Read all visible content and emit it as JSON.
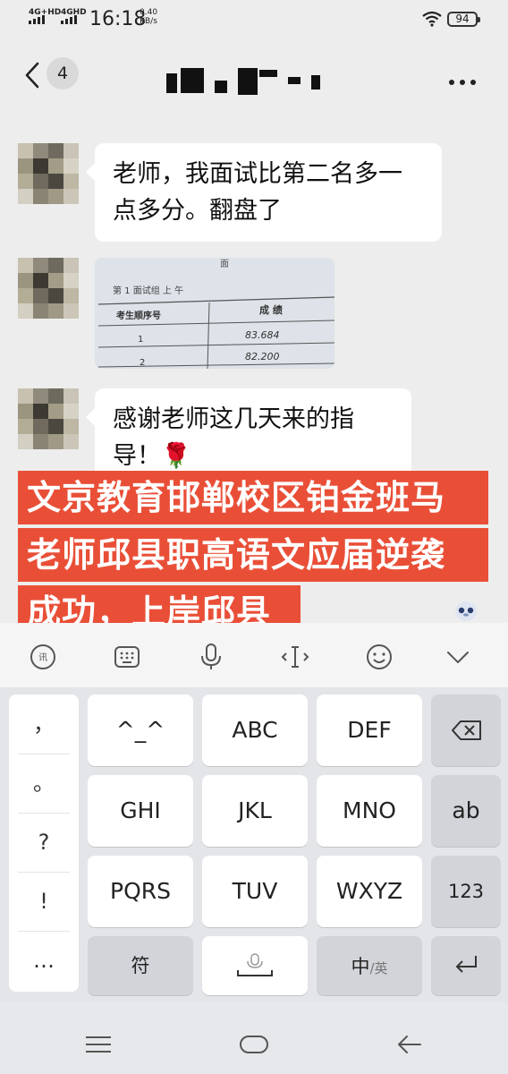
{
  "status_bar": {
    "network_1": "4G+HD",
    "network_2": "4GHD",
    "time": "16:18",
    "speed_value": "0.40",
    "speed_unit": "KB/s",
    "battery": "94"
  },
  "nav": {
    "unread_count": "4",
    "more_icon": "more-icon"
  },
  "messages": [
    {
      "type": "text",
      "text": "老师，我面试比第二名多一点多分。翻盘了"
    },
    {
      "type": "image",
      "photo": {
        "title_fragment": "面",
        "row0": "第   1   面试组   上   午",
        "col_1": "考生顺序号",
        "col_2": "成  绩",
        "rows": [
          {
            "seq": "1",
            "score": "83.684"
          },
          {
            "seq": "2",
            "score": "82.200"
          }
        ]
      }
    },
    {
      "type": "text",
      "text": "感谢老师这几天来的指导！🌹"
    }
  ],
  "overlay_caption": {
    "line1": "文京教育邯郸校区铂金班马",
    "line2": "老师邱县职高语文应届逆袭",
    "line3": "成功，上岸邱县"
  },
  "toolbar_icons": [
    "voice-to-text-icon",
    "keyboard-icon",
    "microphone-icon",
    "text-cursor-icon",
    "emoji-icon",
    "collapse-icon"
  ],
  "keyboard": {
    "side_symbols": [
      "，",
      "。",
      "?",
      "!",
      "…"
    ],
    "keys": {
      "k_emoticon": "^_^",
      "k_abc": "ABC",
      "k_def": "DEF",
      "k_ghi": "GHI",
      "k_jkl": "JKL",
      "k_mno": "MNO",
      "k_pqrs": "PQRS",
      "k_tuv": "TUV",
      "k_wxyz": "WXYZ",
      "k_ab": "ab",
      "k_123": "123",
      "k_symbol": "符",
      "k_zh": "中",
      "k_en": "/英"
    }
  },
  "system_nav": [
    "menu-icon",
    "home-icon",
    "back-icon"
  ]
}
